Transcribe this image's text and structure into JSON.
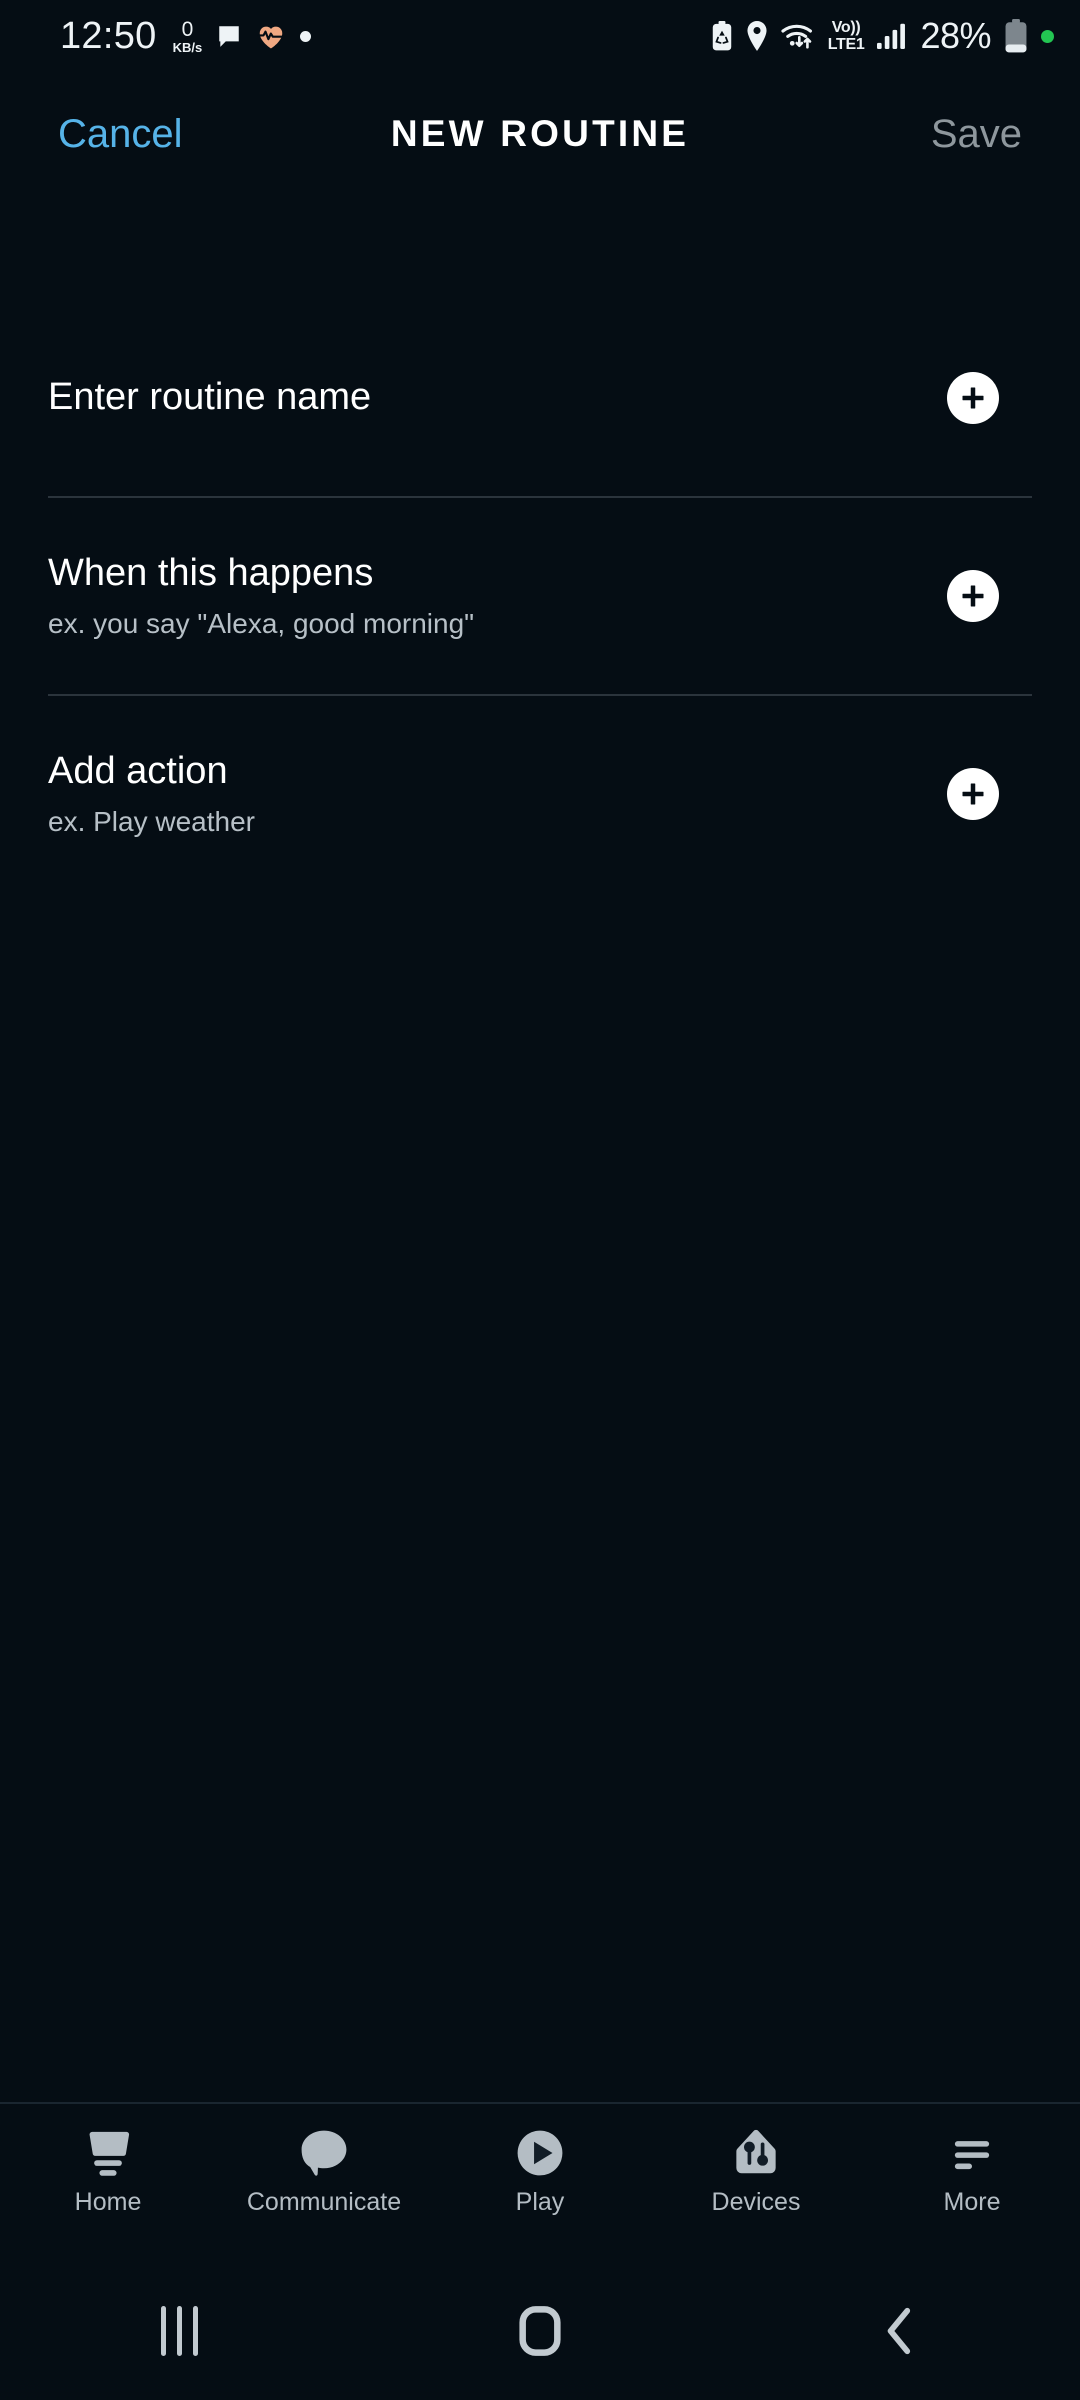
{
  "status_bar": {
    "time": "12:50",
    "net_speed_value": "0",
    "net_speed_unit": "KB/s",
    "battery_percent": "28%",
    "volte_top": "Vo))",
    "volte_bottom": "LTE1",
    "icons": {
      "message": "message-bubble-icon",
      "heart_rate": "heart-rate-icon",
      "notification_dot": "notification-dot-icon",
      "battery_saver": "battery-saver-icon",
      "location": "location-pin-icon",
      "wifi": "wifi-icon",
      "signal": "cellular-signal-icon",
      "battery": "battery-icon",
      "recording_dot": "green-status-dot-icon"
    }
  },
  "header": {
    "cancel_label": "Cancel",
    "title": "NEW ROUTINE",
    "save_label": "Save",
    "cancel_color": "#56b3e8",
    "save_color": "#8e979d"
  },
  "rows": [
    {
      "title": "Enter routine name",
      "subtitle": "",
      "add_icon": "plus-icon"
    },
    {
      "title": "When this happens",
      "subtitle": "ex. you say \"Alexa, good morning\"",
      "add_icon": "plus-icon"
    },
    {
      "title": "Add action",
      "subtitle": "ex. Play weather",
      "add_icon": "plus-icon"
    }
  ],
  "bottom_nav": {
    "items": [
      {
        "label": "Home",
        "icon": "echo-speaker-icon"
      },
      {
        "label": "Communicate",
        "icon": "speech-bubble-icon"
      },
      {
        "label": "Play",
        "icon": "play-circle-icon"
      },
      {
        "label": "Devices",
        "icon": "home-devices-icon"
      },
      {
        "label": "More",
        "icon": "hamburger-menu-icon"
      }
    ]
  },
  "system_nav": {
    "recents": "recent-apps-icon",
    "home": "home-button-icon",
    "back": "back-chevron-icon"
  },
  "theme": {
    "background": "#050d14",
    "text_primary": "#ffffff",
    "text_secondary": "#b7c0c7",
    "divider": "#2b343c",
    "nav_icon": "#b4bdc4"
  }
}
